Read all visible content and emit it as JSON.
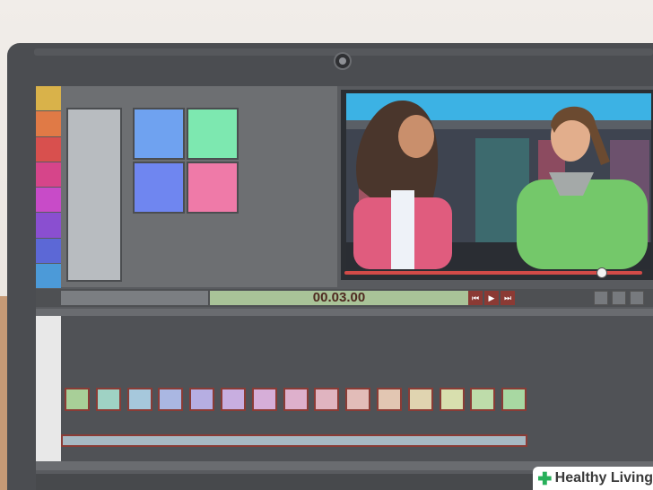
{
  "palette": {
    "swatches": [
      "#d9b24a",
      "#e07a46",
      "#d8504e",
      "#d6458a",
      "#c84bc8",
      "#8a4fd0",
      "#5c68d6",
      "#4c9ad8"
    ]
  },
  "left_panel": {
    "tiles": [
      "#6fa2f0",
      "#7de8b0",
      "#6f86f0",
      "#ef7aa8"
    ]
  },
  "player": {
    "timecode": "00.03.00",
    "progress": 0.86,
    "buttons": [
      "prev-frame",
      "play",
      "next-frame"
    ]
  },
  "timeline": {
    "clips": [
      "#a8cf98",
      "#9fd2c4",
      "#a6c8dc",
      "#aab7e2",
      "#b6aee2",
      "#c8aee0",
      "#d6aed8",
      "#deb0cc",
      "#e0b4c0",
      "#e2bcb8",
      "#e2c6b2",
      "#e0d4b0",
      "#d8dfae",
      "#bedcaa",
      "#a8d8a2"
    ]
  },
  "watermark": {
    "text": "Healthy Living",
    "icon": "plus-cross-icon",
    "accent": "#27b05a"
  }
}
